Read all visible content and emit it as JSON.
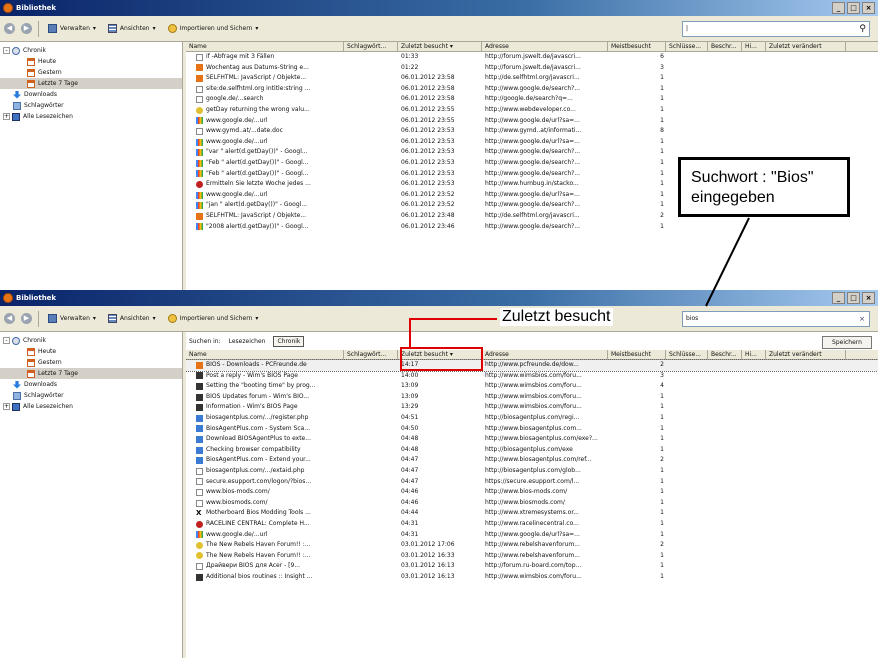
{
  "window_title": "Bibliothek",
  "toolbar": {
    "back": "◀",
    "forward": "▶",
    "organize_label": "Verwalten",
    "views_label": "Ansichten",
    "import_label": "Importieren und Sichern"
  },
  "top": {
    "search_value": "|",
    "tree": [
      {
        "label": "Chronik",
        "icon": "clock-icon",
        "indent": 0,
        "expander": "-"
      },
      {
        "label": "Heute",
        "icon": "calendar-icon",
        "indent": 1
      },
      {
        "label": "Gestern",
        "icon": "calendar-icon",
        "indent": 1
      },
      {
        "label": "Letzte 7 Tage",
        "icon": "calendar-icon",
        "indent": 1,
        "selected": true
      },
      {
        "label": "Downloads",
        "icon": "download-icon",
        "indent": 0
      },
      {
        "label": "Schlagwörter",
        "icon": "tag-icon",
        "indent": 0
      },
      {
        "label": "Alle Lesezeichen",
        "icon": "star-icon",
        "indent": 0,
        "expander": "+"
      }
    ],
    "columns": [
      "Name",
      "Schlagwört...",
      "Zuletzt besucht",
      "Adresse",
      "Meistbesucht",
      "Schlüsse...",
      "Beschr...",
      "Hi...",
      "Zuletzt verändert"
    ],
    "rows": [
      {
        "icon": "page",
        "name": "if -Abfrage mit 3 Fällen",
        "date": "01:33",
        "addr": "http://forum.jswelt.de/javascri...",
        "visits": "6"
      },
      {
        "icon": "orange",
        "name": "Wochentag aus Datums-String e...",
        "date": "01:22",
        "addr": "http://forum.jswelt.de/javascri...",
        "visits": "3"
      },
      {
        "icon": "orange",
        "name": "SELFHTML: JavaScript / Objekte...",
        "date": "06.01.2012 23:58",
        "addr": "http://de.selfhtml.org/javascri...",
        "visits": "1"
      },
      {
        "icon": "page",
        "name": "site:de.selfhtml.org intitle:string ...",
        "date": "06.01.2012 23:58",
        "addr": "http://www.google.de/search?...",
        "visits": "1"
      },
      {
        "icon": "page",
        "name": "google.de/...search",
        "date": "06.01.2012 23:58",
        "addr": "http://google.de/search?q=...",
        "visits": "1"
      },
      {
        "icon": "yellow",
        "name": "getDay returning the wrong valu...",
        "date": "06.01.2012 23:55",
        "addr": "http://www.webdeveloper.co...",
        "visits": "1"
      },
      {
        "icon": "g",
        "name": "www.google.de/...url",
        "date": "06.01.2012 23:55",
        "addr": "http://www.google.de/url?sa=...",
        "visits": "1"
      },
      {
        "icon": "page",
        "name": "www.gymd..at/...date.doc",
        "date": "06.01.2012 23:53",
        "addr": "http://www.gymd..at/informati...",
        "visits": "8"
      },
      {
        "icon": "g",
        "name": "www.google.de/...url",
        "date": "06.01.2012 23:53",
        "addr": "http://www.google.de/url?sa=...",
        "visits": "1"
      },
      {
        "icon": "g",
        "name": "\"var \" alert(d.getDay())\" - Googl...",
        "date": "06.01.2012 23:53",
        "addr": "http://www.google.de/search?...",
        "visits": "1"
      },
      {
        "icon": "g",
        "name": "\"Feb \" alert(d.getDay())\" - Googl...",
        "date": "06.01.2012 23:53",
        "addr": "http://www.google.de/search?...",
        "visits": "1"
      },
      {
        "icon": "g",
        "name": "\"Feb \" alert(d.getDay())\" - Googl...",
        "date": "06.01.2012 23:53",
        "addr": "http://www.google.de/search?...",
        "visits": "1"
      },
      {
        "icon": "red",
        "name": "Ermitteln Sie letzte Woche jedes ...",
        "date": "06.01.2012 23:53",
        "addr": "http://www.humbug.in/stacko...",
        "visits": "1"
      },
      {
        "icon": "g",
        "name": "www.google.de/...url",
        "date": "06.01.2012 23:52",
        "addr": "http://www.google.de/url?sa=...",
        "visits": "1"
      },
      {
        "icon": "g",
        "name": "\"jan \" alert(d.getDay())\" - Googl...",
        "date": "06.01.2012 23:52",
        "addr": "http://www.google.de/search?...",
        "visits": "1"
      },
      {
        "icon": "orange",
        "name": "SELFHTML: JavaScript / Objekte...",
        "date": "06.01.2012 23:48",
        "addr": "http://de.selfhtml.org/javascri...",
        "visits": "2"
      },
      {
        "icon": "g",
        "name": "\"2008 alert(d.getDay())\" - Googl...",
        "date": "06.01.2012 23:46",
        "addr": "http://www.google.de/search?...",
        "visits": "1"
      }
    ]
  },
  "bottom": {
    "search_value": "bios",
    "clear": "×",
    "search_in_label": "Suchen in:",
    "scope_bookmarks": "Lesezeichen",
    "scope_history": "Chronik",
    "save_label": "Speichern",
    "tree": [
      {
        "label": "Chronik",
        "icon": "clock-icon",
        "indent": 0,
        "expander": "-"
      },
      {
        "label": "Heute",
        "icon": "calendar-icon",
        "indent": 1
      },
      {
        "label": "Gestern",
        "icon": "calendar-icon",
        "indent": 1
      },
      {
        "label": "Letzte 7 Tage",
        "icon": "calendar-icon",
        "indent": 1,
        "selected": true
      },
      {
        "label": "Downloads",
        "icon": "download-icon",
        "indent": 0
      },
      {
        "label": "Schlagwörter",
        "icon": "tag-icon",
        "indent": 0
      },
      {
        "label": "Alle Lesezeichen",
        "icon": "star-icon",
        "indent": 0,
        "expander": "+"
      }
    ],
    "columns": [
      "Name",
      "Schlagwört...",
      "Zuletzt besucht",
      "Adresse",
      "Meistbesucht",
      "Schlüsse...",
      "Beschr...",
      "Hi...",
      "Zuletzt verändert"
    ],
    "rows": [
      {
        "icon": "orange",
        "name": "BIOS - Downloads - PCFreunde.de",
        "date": "14:17",
        "addr": "http://www.pcfreunde.de/dow...",
        "visits": "2",
        "selected": true
      },
      {
        "icon": "dark",
        "name": "Post a reply - Wim's BIOS Page",
        "date": "14:00",
        "addr": "http://www.wimsbios.com/foru...",
        "visits": "3"
      },
      {
        "icon": "dark",
        "name": "Setting the \"booting time\" by prog...",
        "date": "13:09",
        "addr": "http://www.wimsbios.com/foru...",
        "visits": "4"
      },
      {
        "icon": "dark",
        "name": "BIOS Updates forum - Wim's BIO...",
        "date": "13:09",
        "addr": "http://www.wimsbios.com/foru...",
        "visits": "1"
      },
      {
        "icon": "dark",
        "name": "Information - Wim's BIOS Page",
        "date": "13:29",
        "addr": "http://www.wimsbios.com/foru...",
        "visits": "1"
      },
      {
        "icon": "blue",
        "name": "biosagentplus.com/.../register.php",
        "date": "04:51",
        "addr": "http://biosagentplus.com/regi...",
        "visits": "1"
      },
      {
        "icon": "blue",
        "name": "BiosAgentPlus.com - System Sca...",
        "date": "04:50",
        "addr": "http://www.biosagentplus.com...",
        "visits": "1"
      },
      {
        "icon": "blue",
        "name": "Download BIOSAgentPlus to exte...",
        "date": "04:48",
        "addr": "http://www.biosagentplus.com/exe?...",
        "visits": "1"
      },
      {
        "icon": "blue",
        "name": "Checking browser compatibility",
        "date": "04:48",
        "addr": "http://biosagentplus.com/exe",
        "visits": "1"
      },
      {
        "icon": "blue",
        "name": "BiosAgentPlus.com - Extend your...",
        "date": "04:47",
        "addr": "http://www.biosagentplus.com/ref...",
        "visits": "2"
      },
      {
        "icon": "page",
        "name": "biosagentplus.com/.../extaid.php",
        "date": "04:47",
        "addr": "http://biosagentplus.com/glob...",
        "visits": "1"
      },
      {
        "icon": "page",
        "name": "secure.esupport.com/logon/?bios...",
        "date": "04:47",
        "addr": "https://secure.esupport.com/l...",
        "visits": "1"
      },
      {
        "icon": "page",
        "name": "www.bios-mods.com/",
        "date": "04:46",
        "addr": "http://www.bios-mods.com/",
        "visits": "1"
      },
      {
        "icon": "page",
        "name": "www.biosmods.com/",
        "date": "04:46",
        "addr": "http://www.biosmods.com/",
        "visits": "1"
      },
      {
        "icon": "x",
        "name": "Motherboard Bios Modding Tools ...",
        "date": "04:44",
        "addr": "http://www.xtremesystems.or...",
        "visits": "1"
      },
      {
        "icon": "red",
        "name": "RACELINE CENTRAL: Complete H...",
        "date": "04:31",
        "addr": "http://www.racelinecentral.co...",
        "visits": "1"
      },
      {
        "icon": "g",
        "name": "www.google.de/...url",
        "date": "04:31",
        "addr": "http://www.google.de/url?sa=...",
        "visits": "1"
      },
      {
        "icon": "yellow",
        "name": "The New Rebels Haven Forum!! :...",
        "date": "03.01.2012 17:06",
        "addr": "http://www.rebelshavenforum...",
        "visits": "2"
      },
      {
        "icon": "yellow",
        "name": "The New Rebels Haven Forum!! :...",
        "date": "03.01.2012 16:33",
        "addr": "http://www.rebelshavenforum...",
        "visits": "1"
      },
      {
        "icon": "page",
        "name": "Драйвери BIOS для Acer - [9...",
        "date": "03.01.2012 16:13",
        "addr": "http://forum.ru-board.com/top...",
        "visits": "1"
      },
      {
        "icon": "dark",
        "name": "Additional bios routines :: Insight ...",
        "date": "03.01.2012 16:13",
        "addr": "http://www.wimsbios.com/foru...",
        "visits": "1"
      }
    ]
  },
  "annotations": {
    "callout_text": "Suchwort : \"Bios\" eingegeben",
    "label_text": "Zuletzt besucht"
  }
}
